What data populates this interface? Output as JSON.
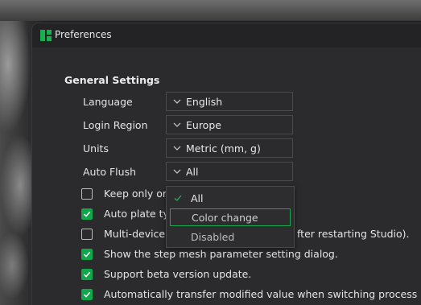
{
  "window": {
    "title": "Preferences"
  },
  "section": {
    "title": "General Settings"
  },
  "settings": [
    {
      "label": "Language",
      "value": "English"
    },
    {
      "label": "Login Region",
      "value": "Europe"
    },
    {
      "label": "Units",
      "value": "Metric (mm, g)"
    },
    {
      "label": "Auto Flush",
      "value": "All"
    }
  ],
  "checkboxes": [
    {
      "label": "Keep only or",
      "checked": false
    },
    {
      "label": "Auto plate ty",
      "checked": true
    },
    {
      "label": "Multi-device",
      "label_tail": "fter restarting Studio).",
      "checked": false
    },
    {
      "label": "Show the step mesh parameter setting dialog.",
      "checked": true
    },
    {
      "label": "Support beta version update.",
      "checked": true
    },
    {
      "label": "Automatically transfer modified value when switching process and",
      "checked": true
    }
  ],
  "dropdown": {
    "options": [
      "All",
      "Color change",
      "Disabled"
    ],
    "selected": "All",
    "hovered": "Color change"
  },
  "colors": {
    "accent": "#10a64a",
    "window_bg": "#2b2b2d",
    "titlebar_bg": "#232325"
  }
}
